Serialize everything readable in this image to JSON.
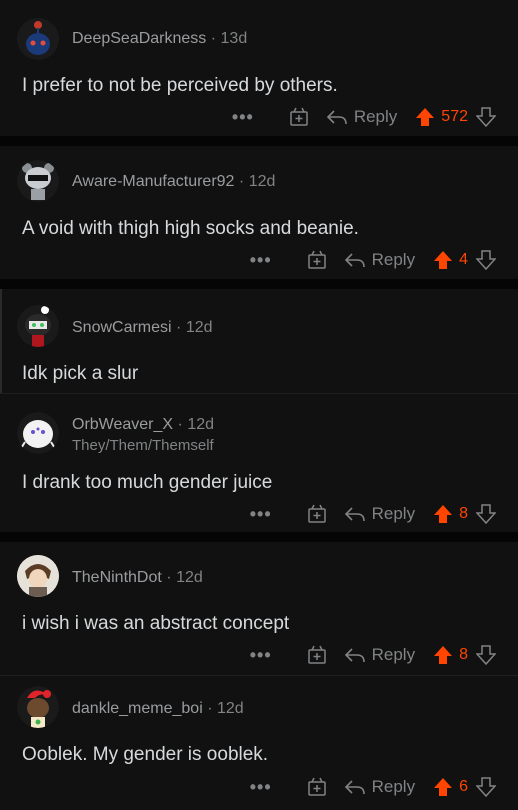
{
  "colors": {
    "background": "#0f0f10",
    "upvote": "#ff4500",
    "muted": "#818384",
    "text": "#d7dadc"
  },
  "comments": [
    {
      "username": "DeepSeaDarkness",
      "time": "13d",
      "body": "I prefer to not be perceived by others.",
      "more_label": "•••",
      "reply_label": "Reply",
      "votes": "572",
      "avatar_icon": "reddit-snoo-avatar-blue"
    },
    {
      "username": "Aware-Manufacturer92",
      "time": "12d",
      "body": "A void with thigh high socks and beanie.",
      "more_label": "•••",
      "reply_label": "Reply",
      "votes": "4",
      "avatar_icon": "reddit-snoo-avatar-sunglasses"
    },
    {
      "username": "SnowCarmesi",
      "time": "12d",
      "body": "Idk pick a slur",
      "avatar_icon": "reddit-snoo-avatar-dark"
    },
    {
      "username": "OrbWeaver_X",
      "time": "12d",
      "flair": "They/Them/Themself",
      "body": "I drank too much gender juice",
      "more_label": "•••",
      "reply_label": "Reply",
      "votes": "8",
      "avatar_icon": "reddit-snoo-avatar-spider"
    },
    {
      "username": "TheNinthDot",
      "time": "12d",
      "body": "i wish i was an abstract concept",
      "more_label": "•••",
      "reply_label": "Reply",
      "votes": "8",
      "avatar_icon": "user-profile-avatar"
    },
    {
      "username": "dankle_meme_boi",
      "time": "12d",
      "body": "Ooblek. My gender is ooblek.",
      "more_label": "•••",
      "reply_label": "Reply",
      "votes": "6",
      "avatar_icon": "reddit-snoo-avatar-redhair"
    }
  ]
}
